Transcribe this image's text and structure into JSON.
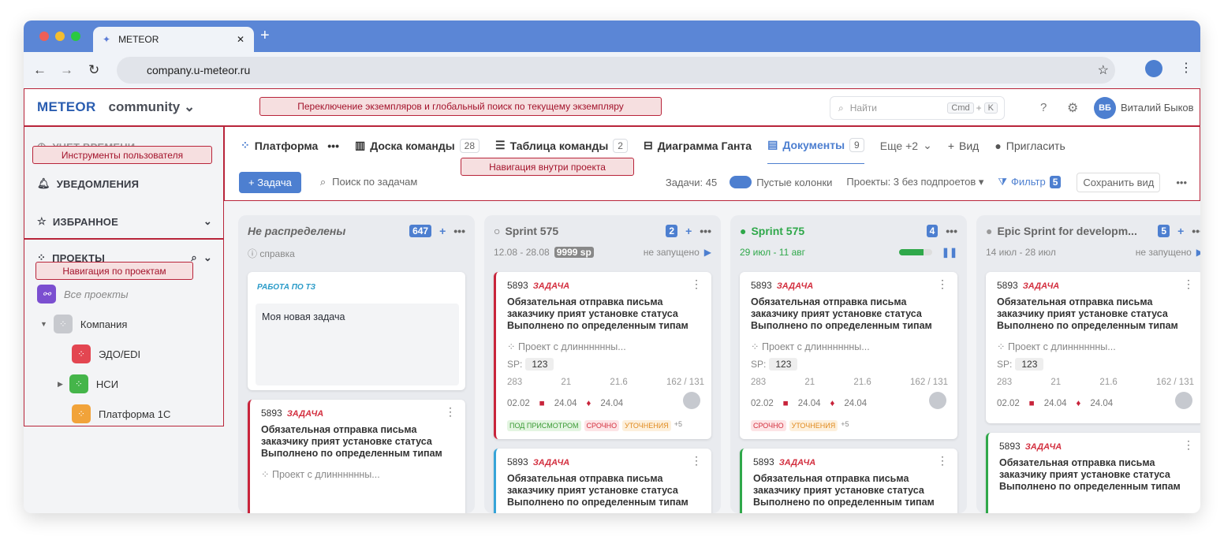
{
  "browser": {
    "tab_title": "METEOR",
    "url": "company.u-meteor.ru"
  },
  "header": {
    "logo": "METEOR",
    "workspace": "community",
    "search_placeholder": "Найти",
    "kbd_cmd": "Cmd",
    "kbd_plus": "+",
    "kbd_k": "K",
    "user_initials": "ВБ",
    "user_name": "Виталий Быков"
  },
  "notes": {
    "header": "Переключение экземпляров и глобальный поиск по текущему экземпляру",
    "user_tools": "Инструменты пользователя",
    "project_nav": "Навигация внутри проекта",
    "projects_nav": "Навигация по проектам"
  },
  "sidebar": {
    "time": "УЧЕТ ВРЕМЕНИ",
    "notifications": "УВЕДОМЛЕНИЯ",
    "favorites": "ИЗБРАННОЕ",
    "projects": "ПРОЕКТЫ",
    "all_projects": "Все проекты",
    "items": [
      {
        "label": "Компания"
      },
      {
        "label": "ЭДО/EDI"
      },
      {
        "label": "НСИ"
      },
      {
        "label": "Платформа 1С"
      }
    ]
  },
  "tabs": {
    "platform": "Платформа",
    "board": "Доска команды",
    "board_count": "28",
    "table": "Таблица команды",
    "table_count": "2",
    "gantt": "Диаграмма Ганта",
    "docs": "Документы",
    "docs_count": "9",
    "more": "Еще +2",
    "view": "Вид",
    "invite": "Пригласить"
  },
  "toolbar": {
    "task": "Задача",
    "search": "Поиск по задачам",
    "count": "Задачи: 45",
    "empty": "Пустые колонки",
    "projects": "Проекты: 3 без подпроетов",
    "filter": "Фильтр",
    "filter_count": "5",
    "save": "Сохранить вид"
  },
  "columns": [
    {
      "title": "Не распределены",
      "count": "647",
      "sub": "справка"
    },
    {
      "title": "Sprint 575",
      "count": "2",
      "dates": "12.08 - 28.08",
      "sp": "9999 sp",
      "status": "не запущено"
    },
    {
      "title": "Sprint 575",
      "count": "4",
      "dates": "29 июл - 11 авг",
      "progress": 0.75
    },
    {
      "title": "Epic Sprint for developm...",
      "count": "5",
      "dates": "14 июл - 28 июл",
      "status": "не запущено"
    }
  ],
  "card": {
    "id": "5893",
    "type": "ЗАДАЧА",
    "title": "Обязательная отправка письма заказчику прият установке статуса Выполнено по определенным типам",
    "project": "Проект с длинннннны...",
    "sp_label": "SP:",
    "sp": "123",
    "s1": "283",
    "s2": "21",
    "s3": "21.6",
    "s4": "162 / 131",
    "d1": "02.02",
    "d2": "24.04",
    "d3": "24.04",
    "more": "+5"
  },
  "col0_group": "РАБОТА ПО ТЗ",
  "col0_new": "Моя новая задача",
  "tags": {
    "review": "ПОД ПРИСМОТРОМ",
    "urgent": "СРОЧНО",
    "clarify": "УТОЧНЕНИЯ"
  }
}
